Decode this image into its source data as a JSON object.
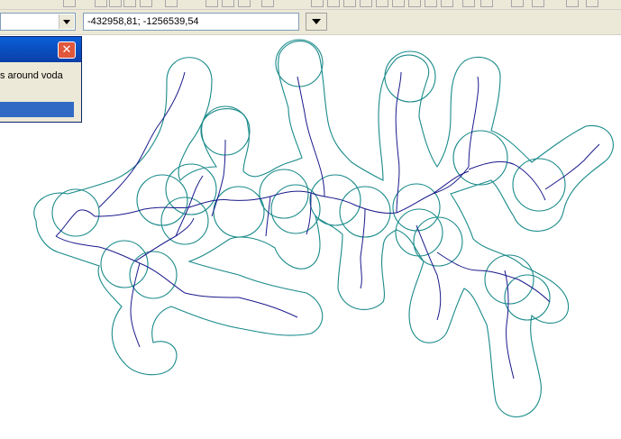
{
  "toolbar": {
    "layer_combo_value": "",
    "coordinates_value": "-432958,81; -1256539,54"
  },
  "dialog": {
    "close_symbol": "✕",
    "message": "s around voda"
  },
  "map": {
    "river_color": "#1a1a8c",
    "buffer_color": "#1a8a8a"
  }
}
